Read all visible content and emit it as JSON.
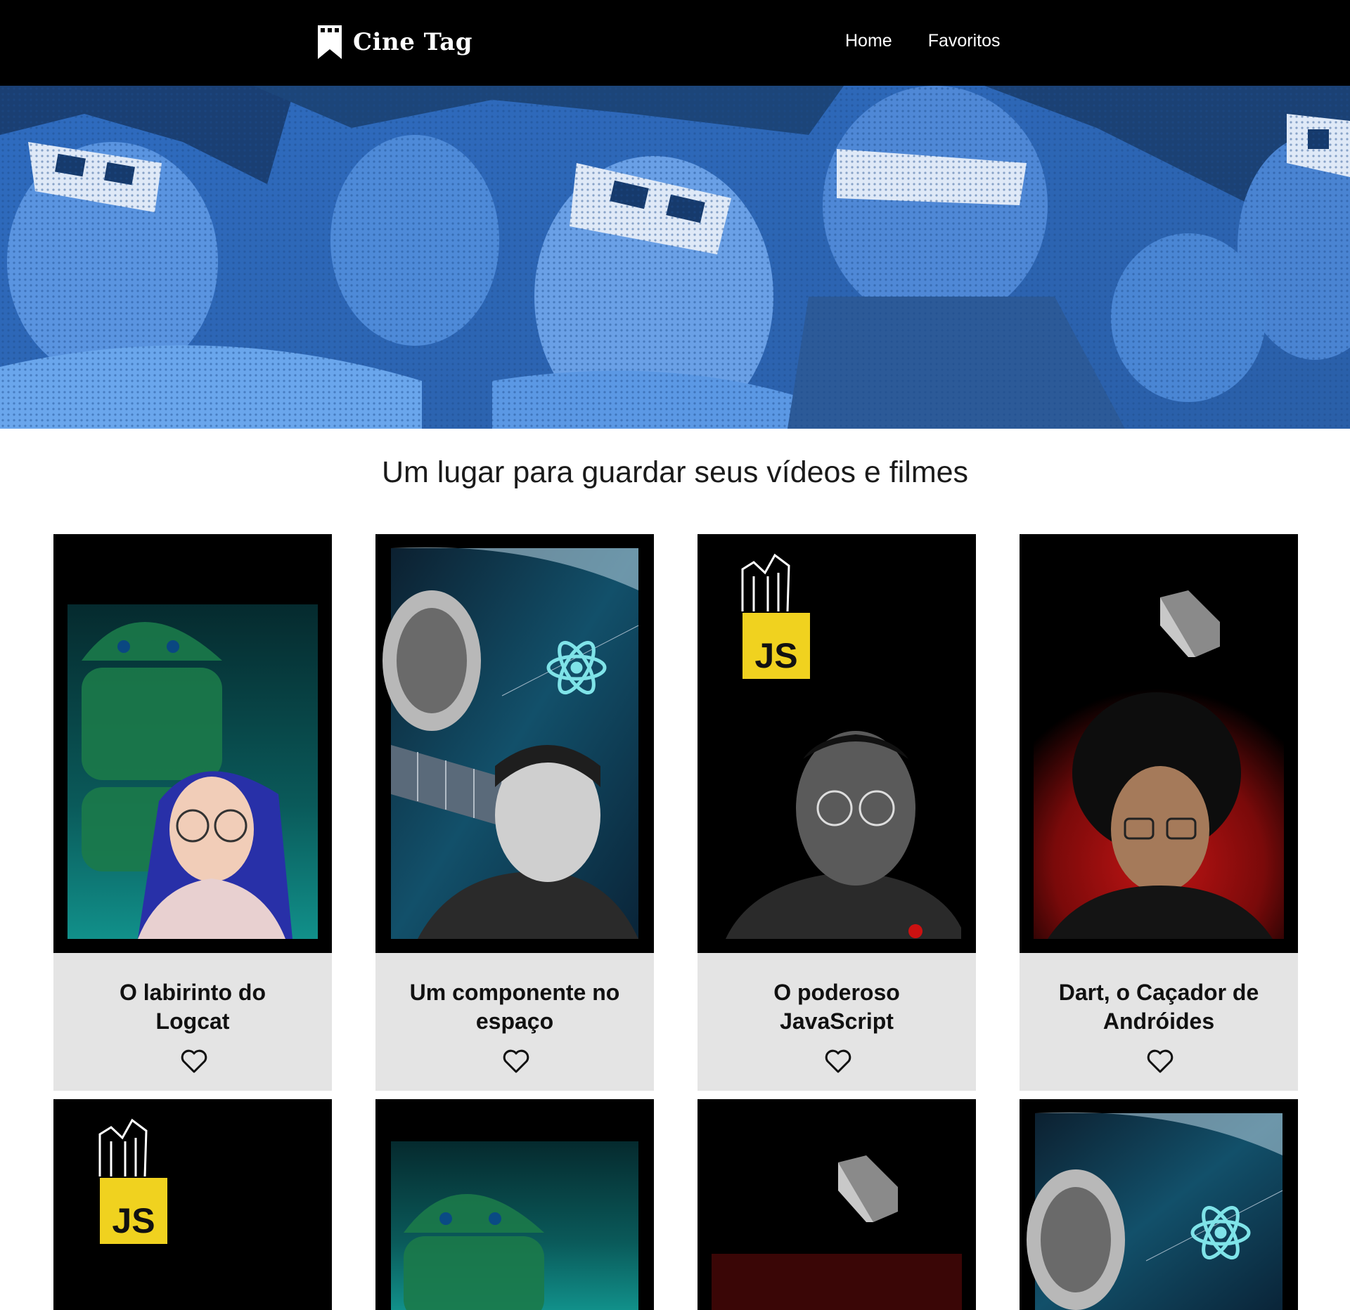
{
  "header": {
    "brand": "Cine Tag",
    "nav": [
      {
        "label": "Home"
      },
      {
        "label": "Favoritos"
      }
    ]
  },
  "tagline": "Um lugar para guardar seus vídeos e filmes",
  "colors": {
    "header_bg": "#000000",
    "banner_tint": "#3a7ad0",
    "card_info_bg": "#e4e4e4",
    "js_yellow": "#f0d21f"
  },
  "cards": [
    {
      "title": "O labirinto do Logcat",
      "theme": "android-icon"
    },
    {
      "title": "Um componente no espaço",
      "theme": "react-icon"
    },
    {
      "title": "O poderoso JavaScript",
      "theme": "js-icon"
    },
    {
      "title": "Dart, o Caçador de Andróides",
      "theme": "dart-icon"
    },
    {
      "title": "",
      "theme": "js-icon"
    },
    {
      "title": "",
      "theme": "android-icon"
    },
    {
      "title": "",
      "theme": "dart-icon"
    },
    {
      "title": "",
      "theme": "react-icon"
    }
  ],
  "icons": {
    "logo": "bookmark-icon",
    "favorite": "heart-outline-icon"
  },
  "js_badge_text": "JS"
}
